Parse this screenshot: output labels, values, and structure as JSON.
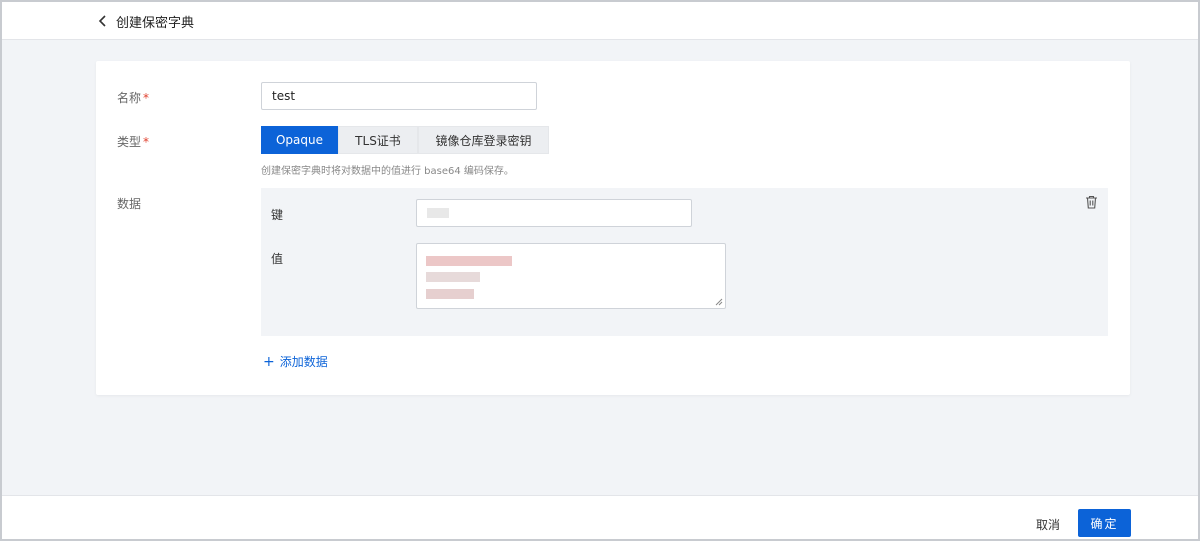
{
  "header": {
    "title": "创建保密字典"
  },
  "form": {
    "name": {
      "label": "名称",
      "required_mark": "*",
      "value": "test"
    },
    "type": {
      "label": "类型",
      "required_mark": "*",
      "options": [
        "Opaque",
        "TLS证书",
        "镜像仓库登录密钥"
      ],
      "selected": "Opaque",
      "hint": "创建保密字典时将对数据中的值进行 base64 编码保存。"
    },
    "data": {
      "label": "数据",
      "key_label": "键",
      "value_label": "值",
      "add_label": "添加数据"
    }
  },
  "footer": {
    "cancel_label": "取消",
    "confirm_label": "确定"
  },
  "colors": {
    "primary": "#0c63d8",
    "required": "#e0412f",
    "page_bg": "#f2f4f7"
  }
}
